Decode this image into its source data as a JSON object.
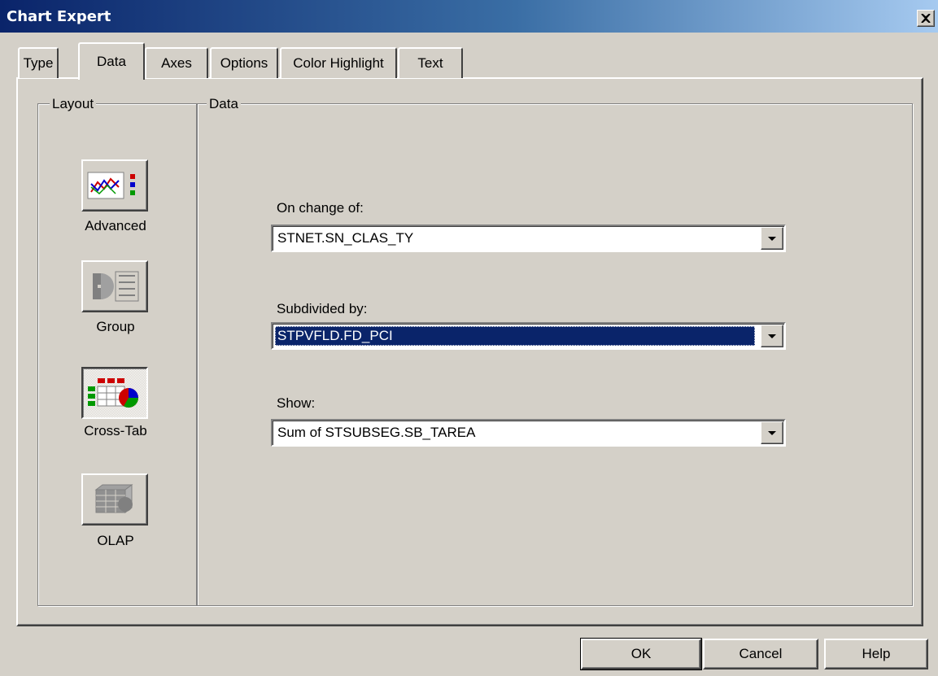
{
  "window": {
    "title": "Chart Expert",
    "close_icon": "×"
  },
  "tabs": [
    {
      "label": "Type"
    },
    {
      "label": "Data",
      "active": true
    },
    {
      "label": "Axes"
    },
    {
      "label": "Options"
    },
    {
      "label": "Color Highlight"
    },
    {
      "label": "Text"
    }
  ],
  "layout_group": {
    "legend": "Layout",
    "items": [
      {
        "label": "Advanced",
        "icon": "advanced-chart-icon"
      },
      {
        "label": "Group",
        "icon": "group-chart-icon"
      },
      {
        "label": "Cross-Tab",
        "icon": "cross-tab-chart-icon",
        "selected": true
      },
      {
        "label": "OLAP",
        "icon": "olap-chart-icon",
        "disabled": true
      }
    ]
  },
  "data_group": {
    "legend": "Data",
    "on_change_of": {
      "label": "On change of:",
      "value": "STNET.SN_CLAS_TY"
    },
    "subdivided_by": {
      "label": "Subdivided by:",
      "value": "STPVFLD.FD_PCI"
    },
    "show": {
      "label": "Show:",
      "value": "Sum of STSUBSEG.SB_TAREA"
    }
  },
  "buttons": {
    "ok": "OK",
    "cancel": "Cancel",
    "help": "Help"
  },
  "colors": {
    "title_start": "#0a246a",
    "title_end": "#a6caf0",
    "face": "#d4d0c8",
    "selection": "#0a246a"
  }
}
